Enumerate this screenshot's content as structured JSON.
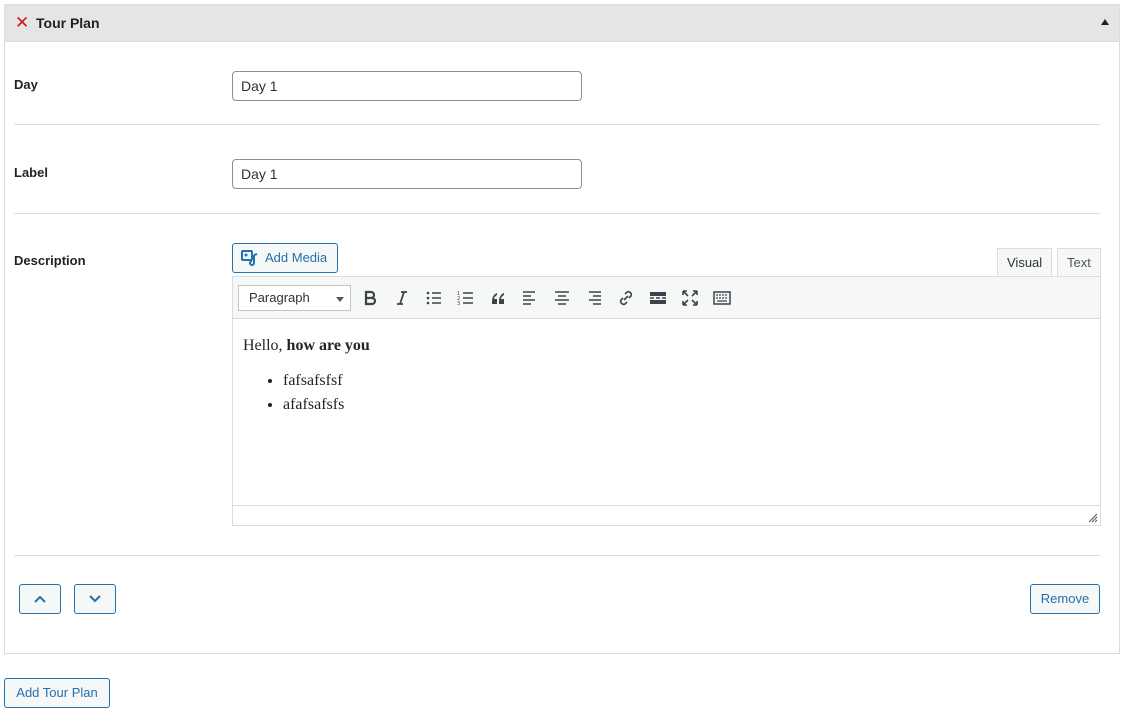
{
  "panel": {
    "title": "Tour Plan",
    "close_icon": "close-icon",
    "collapse_icon": "triangle-up-icon"
  },
  "fields": {
    "day": {
      "label": "Day",
      "value": "Day 1"
    },
    "label": {
      "label": "Label",
      "value": "Day 1"
    },
    "description": {
      "label": "Description"
    }
  },
  "editor": {
    "add_media_label": "Add Media",
    "tabs": {
      "visual": "Visual",
      "text": "Text"
    },
    "active_tab": "Visual",
    "format_select": "Paragraph",
    "toolbar_icons": [
      "bold-icon",
      "italic-icon",
      "bullet-list-icon",
      "numbered-list-icon",
      "blockquote-icon",
      "align-left-icon",
      "align-center-icon",
      "align-right-icon",
      "link-icon",
      "read-more-icon",
      "fullscreen-icon",
      "toolbar-toggle-icon"
    ],
    "content": {
      "intro_plain": "Hello, ",
      "intro_bold": "how are you",
      "list_items": [
        "fafsafsfsf",
        "afafsafsfs"
      ]
    }
  },
  "actions": {
    "move_up_icon": "chevron-up-icon",
    "move_down_icon": "chevron-down-icon",
    "remove_label": "Remove",
    "add_tour_plan_label": "Add Tour Plan"
  },
  "colors": {
    "accent": "#2271b1",
    "danger": "#cc1818",
    "header_bg": "#e5e5e5"
  }
}
